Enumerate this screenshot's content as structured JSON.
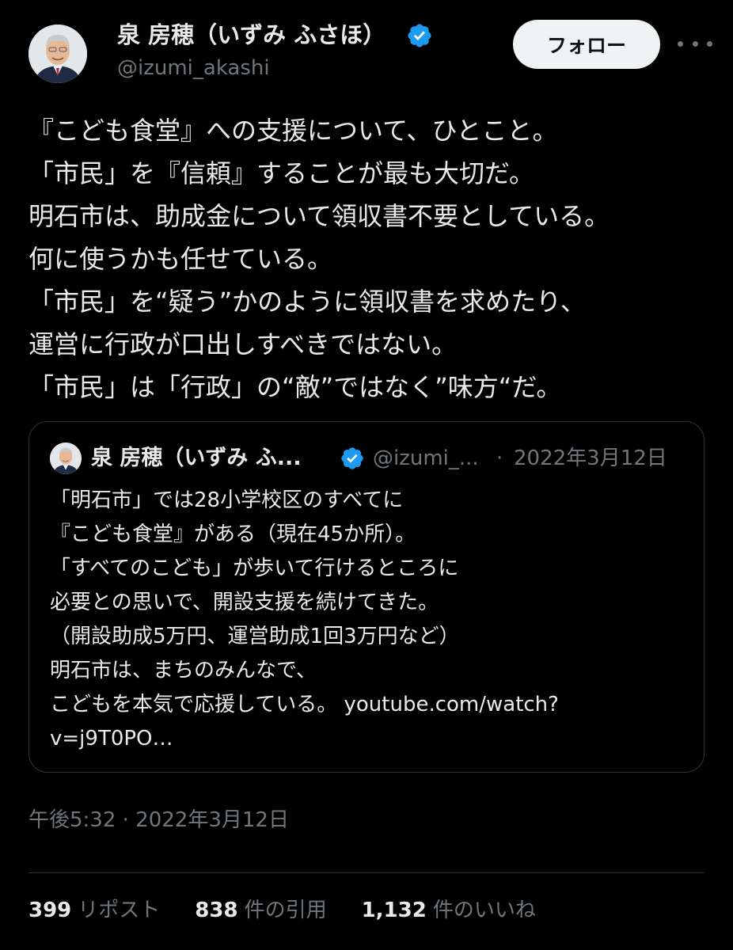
{
  "author": {
    "display_name": "泉 房穂（いずみ ふさほ）",
    "handle": "@izumi_akashi",
    "verified_color": "#1d9bf0"
  },
  "actions": {
    "follow_label": "フォロー",
    "more_icon": "more-horizontal-icon"
  },
  "tweet": {
    "lines": [
      "『こども食堂』への支援について、ひとこと。",
      "「市民」を『信頼』することが最も大切だ。",
      "明石市は、助成金について領収書不要としている。",
      "何に使うかも任せている。",
      "「市民」を“疑う”かのように領収書を求めたり、",
      "運営に行政が口出しすべきではない。",
      "「市民」は「行政」の“敵”ではなく”味方“だ。"
    ],
    "timestamp": "午後5:32 · 2022年3月12日"
  },
  "quote": {
    "display_name": "泉 房穂（いずみ ふ...",
    "handle": "@izumi_...",
    "separator": "·",
    "date": "2022年3月12日",
    "lines": [
      "「明石市」では28小学校区のすべてに",
      "『こども食堂』がある（現在45か所）。",
      "「すべてのこども」が歩いて行けるところに",
      "必要との思いで、開設支援を続けてきた。",
      "（開設助成5万円、運営助成1回3万円など）",
      "明石市は、まちのみんなで、"
    ],
    "last_line_text": "こどもを本気で応援している。",
    "link_part1": "youtube.com/watch?",
    "link_part2": "v=j9T0PO…"
  },
  "stats": {
    "reposts_count": "399",
    "reposts_label": "リポスト",
    "quotes_count": "838",
    "quotes_label": "件の引用",
    "likes_count": "1,132",
    "likes_label": "件のいいね"
  }
}
